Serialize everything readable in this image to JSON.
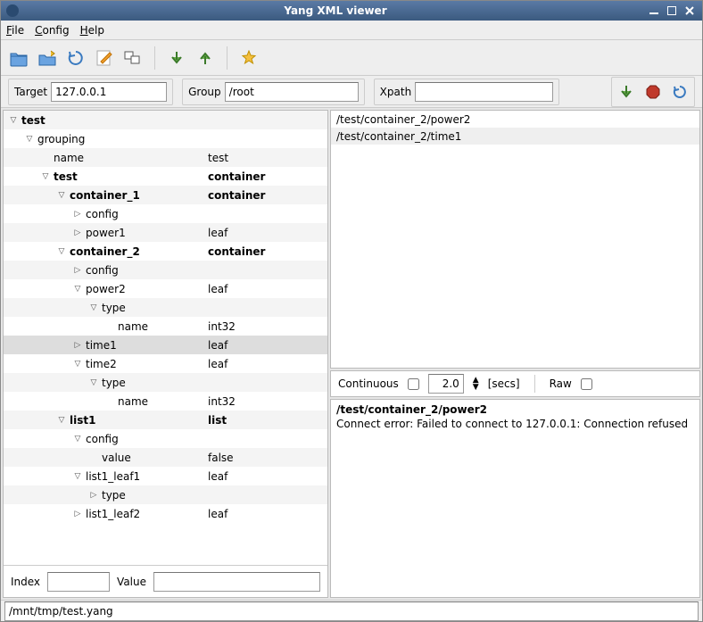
{
  "title": "Yang XML viewer",
  "menu": {
    "file": "File",
    "file_u": "F",
    "config": "Config",
    "config_u": "C",
    "help": "Help",
    "help_u": "H"
  },
  "toolbar_icons": [
    "open",
    "save-as",
    "refresh",
    "edit",
    "windows",
    "down-arrow",
    "up-arrow",
    "star"
  ],
  "ctrl": {
    "target_label": "Target",
    "target_value": "127.0.0.1",
    "group_label": "Group",
    "group_value": "/root",
    "xpath_label": "Xpath",
    "xpath_value": "",
    "right_icons": [
      "download",
      "stop",
      "refresh"
    ]
  },
  "tree": [
    {
      "indent": 0,
      "tog": "▽",
      "name": "test",
      "val": "",
      "bold": true
    },
    {
      "indent": 1,
      "tog": "▽",
      "name": "grouping",
      "val": ""
    },
    {
      "indent": 2,
      "tog": "",
      "name": "name",
      "val": "test"
    },
    {
      "indent": 2,
      "tog": "▽",
      "name": "test",
      "val": "container",
      "bold": true
    },
    {
      "indent": 3,
      "tog": "▽",
      "name": "container_1",
      "val": "container",
      "bold": true
    },
    {
      "indent": 4,
      "tog": "▷",
      "name": "config",
      "val": ""
    },
    {
      "indent": 4,
      "tog": "▷",
      "name": "power1",
      "val": "leaf"
    },
    {
      "indent": 3,
      "tog": "▽",
      "name": "container_2",
      "val": "container",
      "bold": true
    },
    {
      "indent": 4,
      "tog": "▷",
      "name": "config",
      "val": ""
    },
    {
      "indent": 4,
      "tog": "▽",
      "name": "power2",
      "val": "leaf"
    },
    {
      "indent": 5,
      "tog": "▽",
      "name": "type",
      "val": ""
    },
    {
      "indent": 6,
      "tog": "",
      "name": "name",
      "val": "int32"
    },
    {
      "indent": 4,
      "tog": "▷",
      "name": "time1",
      "val": "leaf",
      "sel": true
    },
    {
      "indent": 4,
      "tog": "▽",
      "name": "time2",
      "val": "leaf"
    },
    {
      "indent": 5,
      "tog": "▽",
      "name": "type",
      "val": ""
    },
    {
      "indent": 6,
      "tog": "",
      "name": "name",
      "val": "int32"
    },
    {
      "indent": 3,
      "tog": "▽",
      "name": "list1",
      "val": "list",
      "bold": true
    },
    {
      "indent": 4,
      "tog": "▽",
      "name": "config",
      "val": ""
    },
    {
      "indent": 5,
      "tog": "",
      "name": "value",
      "val": "false"
    },
    {
      "indent": 4,
      "tog": "▽",
      "name": "list1_leaf1",
      "val": "leaf"
    },
    {
      "indent": 5,
      "tog": "▷",
      "name": "type",
      "val": ""
    },
    {
      "indent": 4,
      "tog": "▷",
      "name": "list1_leaf2",
      "val": "leaf"
    }
  ],
  "leftfoot": {
    "index_label": "Index",
    "index_value": "",
    "value_label": "Value",
    "value_value": ""
  },
  "rightlist": [
    "/test/container_2/power2",
    "/test/container_2/time1"
  ],
  "rightctrl": {
    "continuous": "Continuous",
    "interval": "2.0",
    "unit": "[secs]",
    "raw": "Raw"
  },
  "log": {
    "head": "/test/container_2/power2",
    "body": "Connect error: Failed to connect to 127.0.0.1: Connection refused"
  },
  "status": "/mnt/tmp/test.yang"
}
